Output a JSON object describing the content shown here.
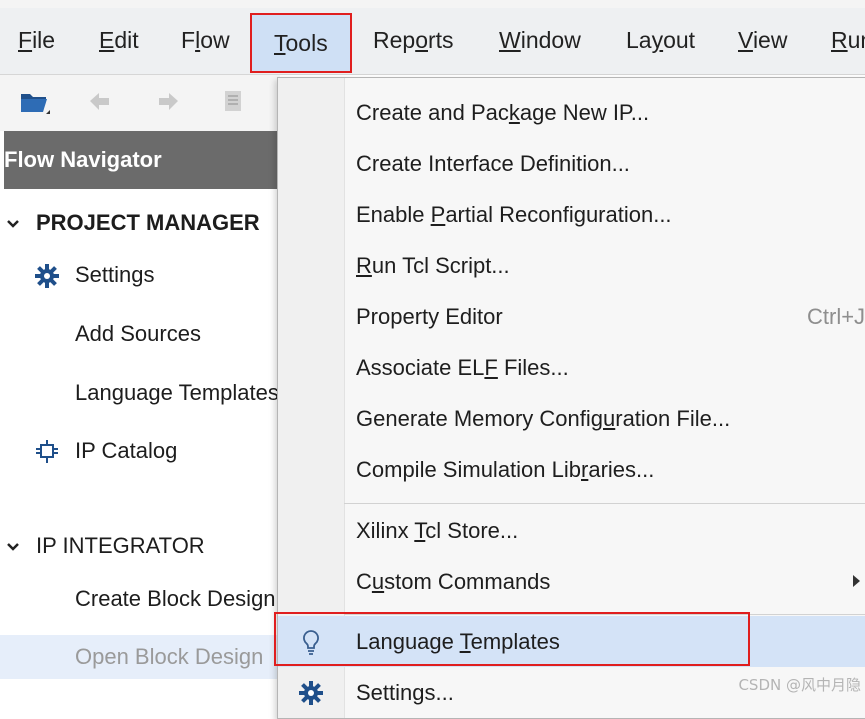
{
  "menubar": {
    "items": [
      {
        "pre": "",
        "mn": "F",
        "post": "ile"
      },
      {
        "pre": "",
        "mn": "E",
        "post": "dit"
      },
      {
        "pre": "F",
        "mn": "l",
        "post": "ow"
      },
      {
        "pre": "",
        "mn": "T",
        "post": "ools"
      },
      {
        "pre": "Rep",
        "mn": "o",
        "post": "rts"
      },
      {
        "pre": "",
        "mn": "W",
        "post": "indow"
      },
      {
        "pre": "La",
        "mn": "y",
        "post": "out"
      },
      {
        "pre": "",
        "mn": "V",
        "post": "iew"
      },
      {
        "pre": "",
        "mn": "R",
        "post": "un"
      }
    ]
  },
  "toolbar": {
    "icons": [
      "open-folder-icon",
      "undo-icon",
      "redo-icon",
      "copy-icon"
    ]
  },
  "flow_navigator": {
    "title": "Flow Navigator",
    "sections": [
      {
        "title": "PROJECT MANAGER",
        "items": [
          "Settings",
          "Add Sources",
          "Language Templates",
          "IP Catalog"
        ]
      },
      {
        "title": "IP INTEGRATOR",
        "items": [
          "Create Block Design",
          "Open Block Design"
        ]
      }
    ]
  },
  "tools_menu": {
    "items": [
      {
        "pre": "Create and Pac",
        "mn": "k",
        "post": "age New IP..."
      },
      {
        "pre": "Create Interface Definition...",
        "mn": "",
        "post": ""
      },
      {
        "pre": "Enable ",
        "mn": "P",
        "post": "artial Reconfiguration..."
      },
      {
        "pre": "",
        "mn": "R",
        "post": "un Tcl Script..."
      },
      {
        "pre": "Property Editor",
        "mn": "",
        "post": "",
        "shortcut": "Ctrl+J"
      },
      {
        "pre": "Associate EL",
        "mn": "F",
        "post": " Files..."
      },
      {
        "pre": "Generate Memory Config",
        "mn": "u",
        "post": "ration File..."
      },
      {
        "pre": "Compile Simulation Lib",
        "mn": "r",
        "post": "aries..."
      },
      {
        "pre": "Xilinx ",
        "mn": "T",
        "post": "cl Store..."
      },
      {
        "pre": "C",
        "mn": "u",
        "post": "stom Commands"
      },
      {
        "pre": "Language ",
        "mn": "T",
        "post": "emplates"
      },
      {
        "pre": "Settings...",
        "mn": "",
        "post": ""
      }
    ]
  },
  "watermark": "CSDN @风中月隐",
  "colors": {
    "highlight_box": "#e01e1e",
    "selected_bg": "#d4e3f7",
    "nav_header_bg": "#6b6b6b"
  }
}
